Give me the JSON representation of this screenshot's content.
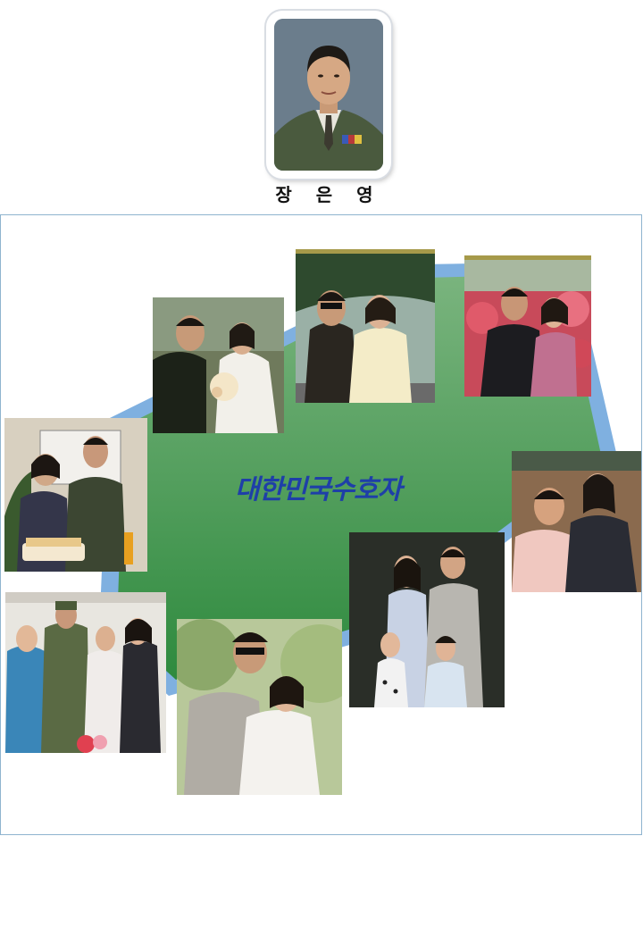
{
  "portrait": {
    "name": "장 은 영"
  },
  "collage": {
    "title": "대한민국수호자"
  }
}
